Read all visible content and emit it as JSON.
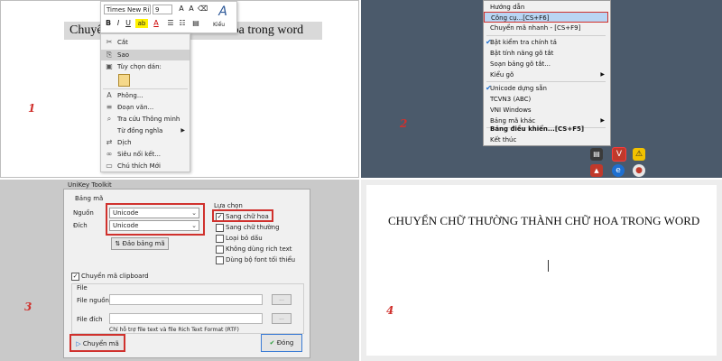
{
  "panel1": {
    "step": "1",
    "doc_text": "Chuyển chữ thường thành chữ hoa trong word",
    "toolbar": {
      "font_name": "Times New Ri",
      "font_size": "9",
      "bold": "B",
      "italic": "I",
      "underline": "U",
      "highlight": "ab",
      "font_color": "A",
      "styles_label": "Kiểu"
    },
    "context_menu": [
      {
        "icon": "cut-icon",
        "glyph": "✂",
        "label": "Cắt"
      },
      {
        "icon": "copy-icon",
        "glyph": "⎘",
        "label": "Sao"
      },
      {
        "icon": "paste-icon",
        "glyph": "📋",
        "label": "Tùy chọn dán:"
      },
      {
        "icon": "font-icon",
        "glyph": "A",
        "label": "Phông..."
      },
      {
        "icon": "paragraph-icon",
        "glyph": "≡",
        "label": "Đoạn văn..."
      },
      {
        "icon": "smart-lookup-icon",
        "glyph": "⌕",
        "label": "Tra cứu Thông minh"
      },
      {
        "icon": "synonyms-icon",
        "glyph": "",
        "label": "Từ đồng nghĩa"
      },
      {
        "icon": "translate-icon",
        "glyph": "⇄",
        "label": "Dịch"
      },
      {
        "icon": "link-icon",
        "glyph": "⛓",
        "label": "Siêu nối kết..."
      },
      {
        "icon": "comment-icon",
        "glyph": "▭",
        "label": "Chú thích Mới"
      }
    ]
  },
  "panel2": {
    "step": "2",
    "menu": [
      {
        "label": "Hướng dẫn",
        "checked": false
      },
      {
        "label": "Công cụ...[CS+F6]",
        "checked": false,
        "highlight": true
      },
      {
        "label": "Chuyển mã nhanh - [CS+F9]",
        "checked": false
      },
      {
        "label": "Bật kiểm tra chính tả",
        "checked": true
      },
      {
        "label": "Bật tính năng gõ tắt",
        "checked": false
      },
      {
        "label": "Soạn bảng gõ tắt...",
        "checked": false
      },
      {
        "label": "Kiểu gõ",
        "checked": false,
        "submenu": true
      },
      {
        "label": "Unicode dựng sẵn",
        "checked": true
      },
      {
        "label": "TCVN3 (ABC)",
        "checked": false
      },
      {
        "label": "VNI Windows",
        "checked": false
      },
      {
        "label": "Bảng mã khác",
        "checked": false,
        "submenu": true
      },
      {
        "label": "Bảng điều khiển...[CS+F5]",
        "checked": false,
        "bold": true
      },
      {
        "label": "Kết thúc",
        "checked": false
      }
    ],
    "unikey_icon": "V"
  },
  "panel3": {
    "step": "3",
    "window_title": "UniKey Toolkit",
    "encoding_group": "Bảng mã",
    "source_label": "Nguồn",
    "source_value": "Unicode",
    "dest_label": "Đích",
    "dest_value": "Unicode",
    "swap_button": "Đảo bảng mã",
    "options_group": "Lựa chọn",
    "options": [
      {
        "label": "Sang chữ hoa",
        "checked": true
      },
      {
        "label": "Sang chữ thường",
        "checked": false
      },
      {
        "label": "Loại bỏ dấu",
        "checked": false
      },
      {
        "label": "Không dùng rich text",
        "checked": false
      },
      {
        "label": "Dùng bộ font tối thiểu",
        "checked": false
      }
    ],
    "clipboard_label": "Chuyển mã clipboard",
    "clipboard_checked": true,
    "file_group": "File",
    "file_source_label": "File nguồn",
    "file_dest_label": "File đích",
    "browse_label": "...",
    "note": "Chỉ hỗ trợ file text và file Rich Text Format (RTF)",
    "convert_button": "Chuyển mã",
    "close_button": "Đóng"
  },
  "panel4": {
    "step": "4",
    "doc_text": "CHUYỂN CHỮ THƯỜNG THÀNH CHỮ HOA TRONG WORD"
  },
  "colors": {
    "highlight_red": "#d0312d",
    "menu_highlight": "#b9d5f3",
    "taskbar": "#4b5a6b"
  }
}
